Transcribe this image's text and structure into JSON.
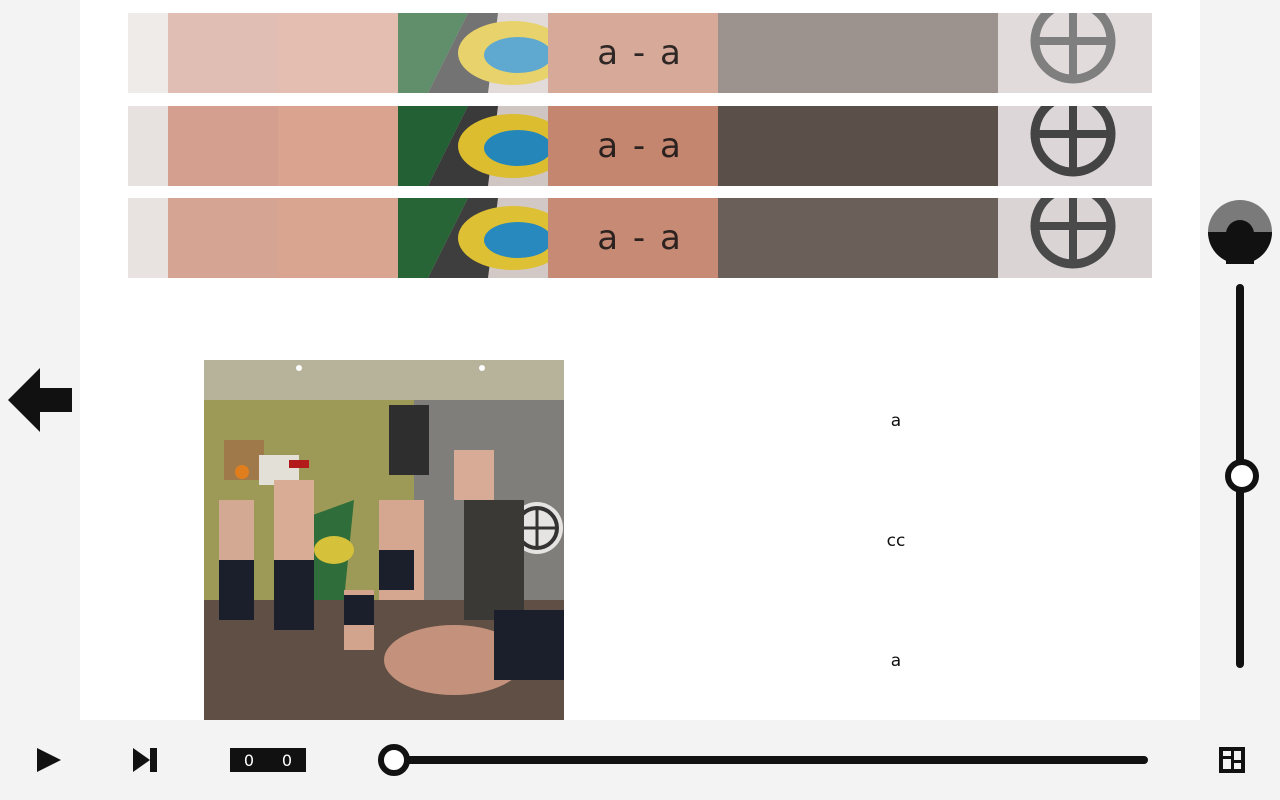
{
  "strips": [
    {
      "label": "a - a"
    },
    {
      "label": "a - a"
    },
    {
      "label": "a - a"
    }
  ],
  "options": [
    "a",
    "cc",
    "a"
  ],
  "progress": {
    "fraction": 0.0
  },
  "volume": {
    "fraction": 0.5
  },
  "counter": {
    "left": "0",
    "right": "0"
  },
  "icons": {
    "back": "arrow-left-icon",
    "volume": "volume-icon",
    "play": "play-icon",
    "skip": "skip-next-icon",
    "layout": "layout-icon",
    "globe": "globe-icon"
  },
  "colors": {
    "accent": "#111111",
    "background": "#f3f3f3",
    "panel": "#ffffff"
  }
}
